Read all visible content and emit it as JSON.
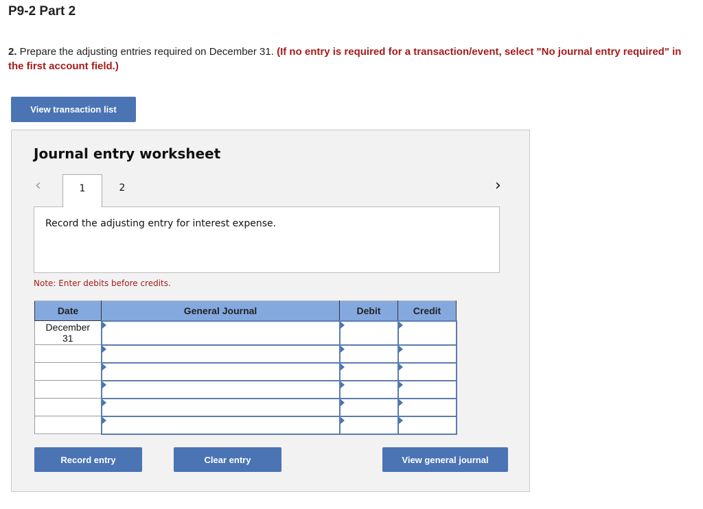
{
  "page": {
    "part_title": "P9-2 Part 2"
  },
  "question": {
    "number": "2.",
    "text": " Prepare the adjusting entries required on December 31. ",
    "instruction": "(If no entry is required for a transaction/event, select \"No journal entry required\" in the first account field.)"
  },
  "buttons": {
    "view_transaction_list": "View transaction list",
    "record_entry": "Record entry",
    "clear_entry": "Clear entry",
    "view_general_journal": "View general journal"
  },
  "worksheet": {
    "title": "Journal entry worksheet",
    "nav_prev_icon": "‹",
    "nav_next_icon": "›",
    "tabs": [
      {
        "label": "1",
        "active": true
      },
      {
        "label": "2",
        "active": false
      }
    ],
    "prompt": "Record the adjusting entry for interest expense.",
    "note": "Note: Enter debits before credits."
  },
  "journal_table": {
    "headers": {
      "date": "Date",
      "account": "General Journal",
      "debit": "Debit",
      "credit": "Credit"
    },
    "rows": [
      {
        "date_line1": "December",
        "date_line2": "31",
        "account": "",
        "debit": "",
        "credit": ""
      },
      {
        "date_line1": "",
        "date_line2": "",
        "account": "",
        "debit": "",
        "credit": ""
      },
      {
        "date_line1": "",
        "date_line2": "",
        "account": "",
        "debit": "",
        "credit": ""
      },
      {
        "date_line1": "",
        "date_line2": "",
        "account": "",
        "debit": "",
        "credit": ""
      },
      {
        "date_line1": "",
        "date_line2": "",
        "account": "",
        "debit": "",
        "credit": ""
      },
      {
        "date_line1": "",
        "date_line2": "",
        "account": "",
        "debit": "",
        "credit": ""
      }
    ]
  },
  "colors": {
    "accent_button": "#4a74b4",
    "table_header": "#84a9df",
    "instruction_red": "#a61b1b",
    "worksheet_bg": "#f2f2f2"
  }
}
